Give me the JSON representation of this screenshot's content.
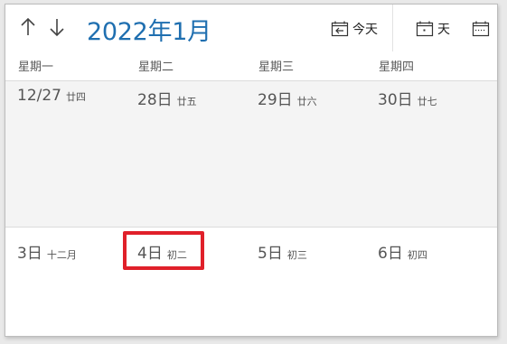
{
  "toolbar": {
    "prev_icon": "arrow-up-icon",
    "next_icon": "arrow-down-icon",
    "title": "2022年1月",
    "today_label": "今天",
    "day_label": "天",
    "week_view_icon": "calendar-week-icon"
  },
  "weekdays": [
    "星期一",
    "星期二",
    "星期三",
    "星期四"
  ],
  "weeks": [
    {
      "days": [
        {
          "num": "12/27",
          "lunar": "廿四"
        },
        {
          "num": "28日",
          "lunar": "廿五"
        },
        {
          "num": "29日",
          "lunar": "廿六"
        },
        {
          "num": "30日",
          "lunar": "廿七"
        }
      ]
    },
    {
      "days": [
        {
          "num": "3日",
          "lunar": "十二月"
        },
        {
          "num": "4日",
          "lunar": "初二"
        },
        {
          "num": "5日",
          "lunar": "初三"
        },
        {
          "num": "6日",
          "lunar": "初四"
        }
      ]
    }
  ],
  "colors": {
    "accent": "#1f6fb0",
    "highlight": "#e0202a",
    "shaded_row": "#f4f4f4"
  }
}
